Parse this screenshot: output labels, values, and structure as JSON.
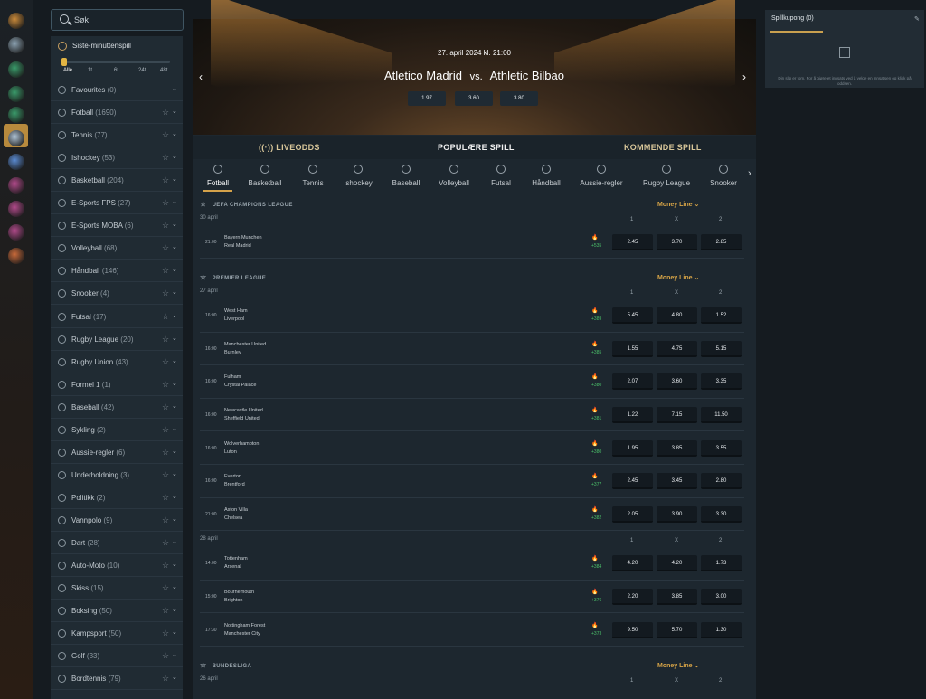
{
  "search": {
    "placeholder": "Søk"
  },
  "last_minute": {
    "title": "Siste-minuttenspill",
    "ticks": [
      "Alle",
      "1t",
      "6t",
      "24t",
      "48t"
    ]
  },
  "sidebar": [
    {
      "name": "Favourites",
      "count": "(0)"
    },
    {
      "name": "Fotball",
      "count": "(1690)"
    },
    {
      "name": "Tennis",
      "count": "(77)"
    },
    {
      "name": "Ishockey",
      "count": "(53)"
    },
    {
      "name": "Basketball",
      "count": "(204)"
    },
    {
      "name": "E-Sports FPS",
      "count": "(27)"
    },
    {
      "name": "E-Sports MOBA",
      "count": "(6)"
    },
    {
      "name": "Volleyball",
      "count": "(68)"
    },
    {
      "name": "Håndball",
      "count": "(146)"
    },
    {
      "name": "Snooker",
      "count": "(4)"
    },
    {
      "name": "Futsal",
      "count": "(17)"
    },
    {
      "name": "Rugby League",
      "count": "(20)"
    },
    {
      "name": "Rugby Union",
      "count": "(43)"
    },
    {
      "name": "Formel 1",
      "count": "(1)"
    },
    {
      "name": "Baseball",
      "count": "(42)"
    },
    {
      "name": "Sykling",
      "count": "(2)"
    },
    {
      "name": "Aussie-regler",
      "count": "(6)"
    },
    {
      "name": "Underholdning",
      "count": "(3)"
    },
    {
      "name": "Politikk",
      "count": "(2)"
    },
    {
      "name": "Vannpolo",
      "count": "(9)"
    },
    {
      "name": "Dart",
      "count": "(28)"
    },
    {
      "name": "Auto-Moto",
      "count": "(10)"
    },
    {
      "name": "Skiss",
      "count": "(15)"
    },
    {
      "name": "Boksing",
      "count": "(50)"
    },
    {
      "name": "Kampsport",
      "count": "(50)"
    },
    {
      "name": "Golf",
      "count": "(33)"
    },
    {
      "name": "Bordtennis",
      "count": "(79)"
    }
  ],
  "hero": {
    "date": "27. april 2024 kl. 21:00",
    "home": "Atletico Madrid",
    "vs": "vs.",
    "away": "Athletic Bilbao",
    "odds": [
      "1.97",
      "3.60",
      "3.80"
    ]
  },
  "tabs": {
    "live": "LIVEODDS",
    "popular": "POPULÆRE SPILL",
    "upcoming": "KOMMENDE SPILL"
  },
  "categories": [
    "Fotball",
    "Basketball",
    "Tennis",
    "Ishockey",
    "Baseball",
    "Volleyball",
    "Futsal",
    "Håndball",
    "Aussie-regler",
    "Rugby League",
    "Snooker"
  ],
  "market": "Money Line",
  "cols": [
    "1",
    "X",
    "2"
  ],
  "leagues": [
    {
      "name": "UEFA CHAMPIONS LEAGUE",
      "days": [
        {
          "date": "30 april",
          "matches": [
            {
              "time": "21:00",
              "home": "Bayern Munchen",
              "away": "Real Madrid",
              "more": "+535",
              "odds": [
                "2.45",
                "3.70",
                "2.85"
              ]
            }
          ]
        }
      ]
    },
    {
      "name": "PREMIER LEAGUE",
      "days": [
        {
          "date": "27 april",
          "matches": [
            {
              "time": "16:00",
              "home": "West Ham",
              "away": "Liverpool",
              "more": "+389",
              "odds": [
                "5.45",
                "4.80",
                "1.52"
              ]
            },
            {
              "time": "16:00",
              "home": "Manchester United",
              "away": "Burnley",
              "more": "+385",
              "odds": [
                "1.55",
                "4.75",
                "5.15"
              ]
            },
            {
              "time": "16:00",
              "home": "Fulham",
              "away": "Crystal Palace",
              "more": "+380",
              "odds": [
                "2.07",
                "3.60",
                "3.35"
              ]
            },
            {
              "time": "16:00",
              "home": "Newcastle United",
              "away": "Sheffield United",
              "more": "+381",
              "odds": [
                "1.22",
                "7.15",
                "11.50"
              ]
            },
            {
              "time": "16:00",
              "home": "Wolverhampton",
              "away": "Luton",
              "more": "+380",
              "odds": [
                "1.95",
                "3.85",
                "3.55"
              ]
            },
            {
              "time": "16:00",
              "home": "Everton",
              "away": "Brentford",
              "more": "+377",
              "odds": [
                "2.45",
                "3.45",
                "2.80"
              ]
            },
            {
              "time": "21:00",
              "home": "Aston Villa",
              "away": "Chelsea",
              "more": "+382",
              "odds": [
                "2.05",
                "3.90",
                "3.30"
              ]
            }
          ]
        },
        {
          "date": "28 april",
          "matches": [
            {
              "time": "14:00",
              "home": "Tottenham",
              "away": "Arsenal",
              "more": "+384",
              "odds": [
                "4.20",
                "4.20",
                "1.73"
              ]
            },
            {
              "time": "15:00",
              "home": "Bournemouth",
              "away": "Brighton",
              "more": "+376",
              "odds": [
                "2.20",
                "3.85",
                "3.00"
              ]
            },
            {
              "time": "17:30",
              "home": "Nottingham Forest",
              "away": "Manchester City",
              "more": "+373",
              "odds": [
                "9.50",
                "5.70",
                "1.30"
              ]
            }
          ]
        }
      ]
    },
    {
      "name": "BUNDESLIGA",
      "days": [
        {
          "date": "26 april",
          "matches": []
        }
      ]
    }
  ],
  "coupon": {
    "title": "Spillkupong (0)",
    "text": "Din slip er tom. For å gjøre et innsats ved å velge en innsatsen og klikk på oddsen."
  },
  "colors": {
    "accent": "#d4a24a",
    "bg": "#151b20",
    "panel": "#1d272f"
  }
}
